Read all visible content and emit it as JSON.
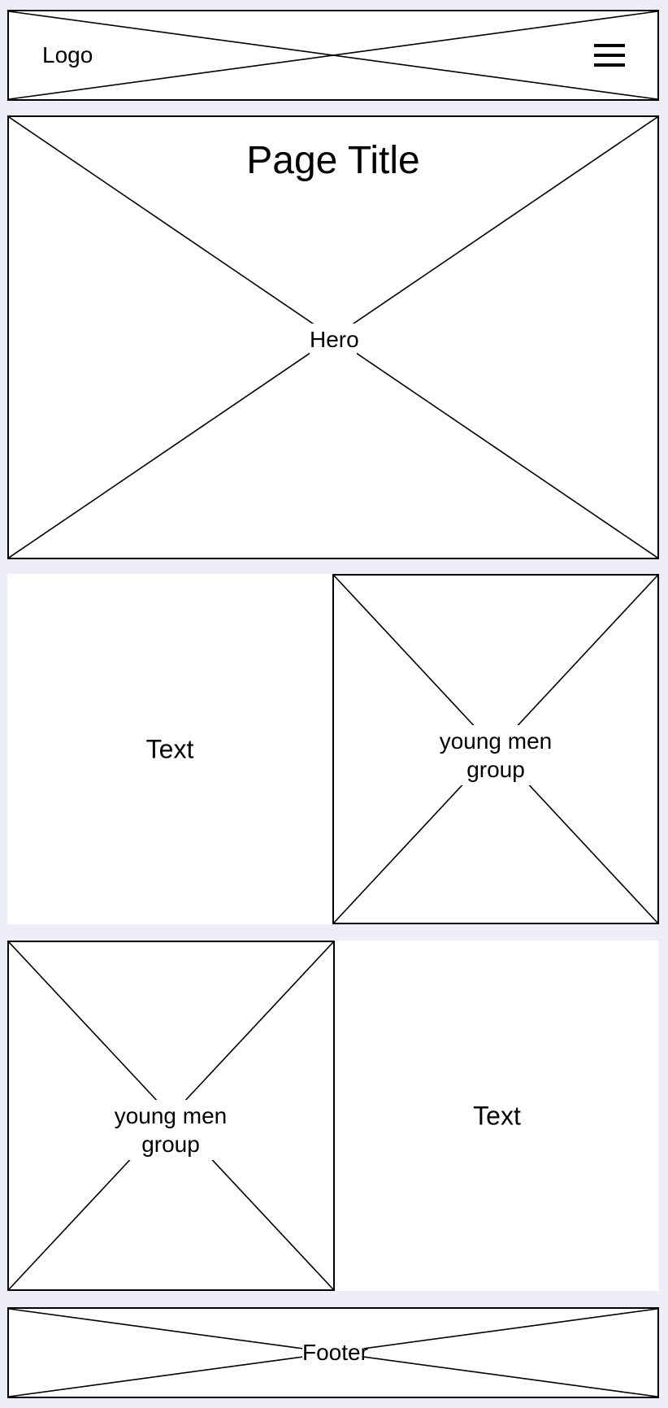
{
  "header": {
    "logo": "Logo",
    "menu_icon": "hamburger-menu-icon"
  },
  "hero": {
    "title": "Page Title",
    "placeholder_label": "Hero"
  },
  "sections": [
    {
      "text": "Text",
      "image_label": "young men group"
    },
    {
      "text": "Text",
      "image_label": "young men group"
    }
  ],
  "footer": {
    "label": "Footer"
  }
}
